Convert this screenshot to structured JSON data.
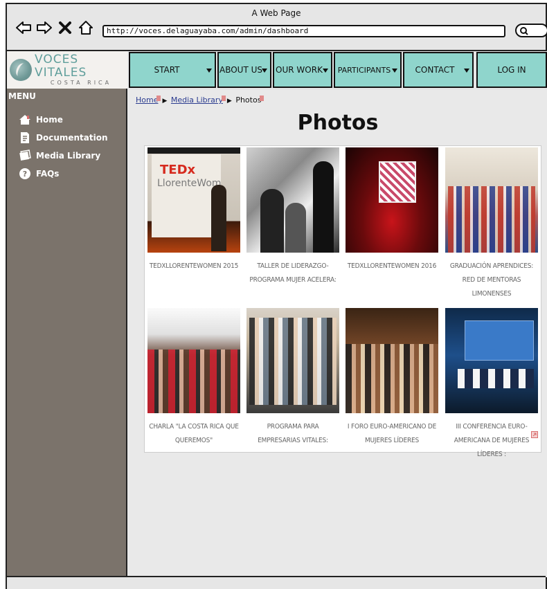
{
  "window": {
    "title": "A Web Page",
    "url": "http://voces.delaguayaba.com/admin/dashboard"
  },
  "logo": {
    "title": "VOCES VITALES",
    "subtitle": "COSTA RICA"
  },
  "sidebar": {
    "heading": "MENU",
    "items": [
      {
        "label": "Home",
        "icon": "home-icon"
      },
      {
        "label": "Documentation",
        "icon": "document-icon"
      },
      {
        "label": "Media Library",
        "icon": "media-icon"
      },
      {
        "label": "FAQs",
        "icon": "question-icon"
      }
    ]
  },
  "nav": {
    "items": [
      {
        "label": "START",
        "dropdown": true
      },
      {
        "label": "ABOUT US",
        "dropdown": true
      },
      {
        "label": "OUR WORK",
        "dropdown": true
      },
      {
        "label": "PARTICIPANTS",
        "dropdown": true
      },
      {
        "label": "CONTACT",
        "dropdown": true
      },
      {
        "label": "LOG IN",
        "dropdown": false
      }
    ]
  },
  "breadcrumb": {
    "home": "Home",
    "media": "Media Library",
    "current": "Photos"
  },
  "page": {
    "title": "Photos"
  },
  "gallery": {
    "items": [
      {
        "caption": "TEDXLLORENTEWOMEN 2015",
        "photo_text_1": "TEDx",
        "photo_text_2": "LlorenteWom"
      },
      {
        "caption": "TALLER DE LIDERAZGO-PROGRAMA MUJER ACELERA:"
      },
      {
        "caption": "TEDXLLORENTEWOMEN 2016"
      },
      {
        "caption": "GRADUACIÓN APRENDICES: RED DE MENTORAS LIMONENSES"
      },
      {
        "caption": "CHARLA \"LA COSTA RICA QUE QUEREMOS\""
      },
      {
        "caption": "PROGRAMA PARA EMPRESARIAS VITALES:"
      },
      {
        "caption": "I FORO EURO-AMERICANO DE MUJERES LÍDERES"
      },
      {
        "caption": "III CONFERENCIA EURO-AMERICANA DE MUJERES LÍDERES :"
      }
    ]
  },
  "colors": {
    "nav_bg": "#8fd5cc",
    "sidebar_bg": "#7b736b",
    "logo_text": "#5f9e9b",
    "link": "#2a3b8f"
  }
}
